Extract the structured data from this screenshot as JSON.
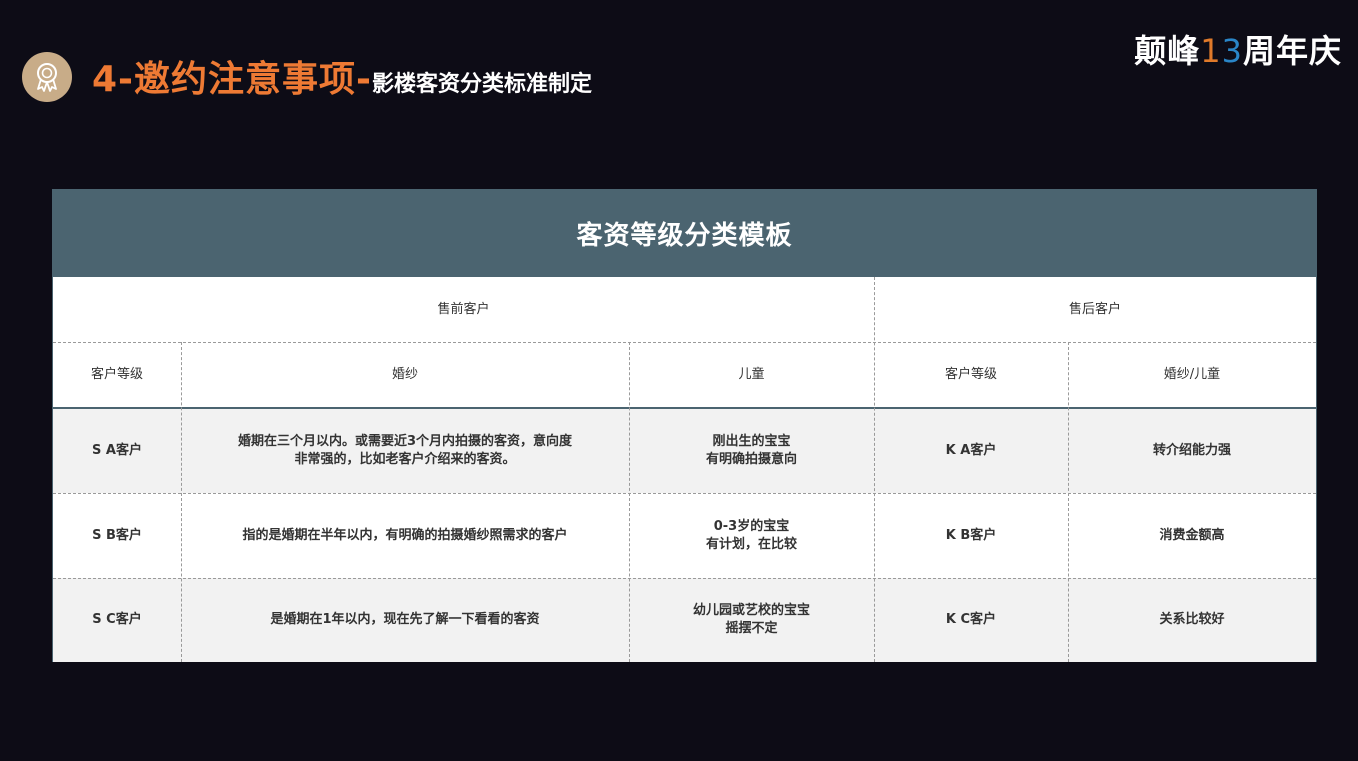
{
  "header": {
    "title_main": "4-邀约注意事项-",
    "title_sub": "影楼客资分类标准制定",
    "brand_prefix": "颠峰",
    "brand_digit1": "1",
    "brand_digit3": "3",
    "brand_suffix": "周年庆"
  },
  "table": {
    "title": "客资等级分类模板",
    "group_presale": "售前客户",
    "group_aftersale": "售后客户",
    "columns": [
      "客户等级",
      "婚纱",
      "儿童",
      "客户等级",
      "婚纱/儿童"
    ],
    "rows": [
      {
        "level": "S A客户",
        "wedding": "婚期在三个月以内。或需要近3个月内拍摄的客资，意向度\n非常强的，比如老客户介绍来的客资。",
        "child": "刚出生的宝宝\n有明确拍摄意向",
        "after_level": "K A客户",
        "after_desc": "转介绍能力强"
      },
      {
        "level": "S B客户",
        "wedding": "指的是婚期在半年以内，有明确的拍摄婚纱照需求的客户",
        "child": "0-3岁的宝宝\n有计划，在比较",
        "after_level": "K B客户",
        "after_desc": "消费金额高"
      },
      {
        "level": "S C客户",
        "wedding": "是婚期在1年以内，现在先了解一下看看的客资",
        "child": "幼儿园或艺校的宝宝\n摇摆不定",
        "after_level": "K C客户",
        "after_desc": "关系比较好"
      }
    ]
  },
  "colors": {
    "background": "#0d0c16",
    "accent_orange": "#ee7a34",
    "table_header": "#4b6470",
    "badge": "#c8ac88"
  },
  "icons": {
    "badge": "award-ribbon-icon"
  }
}
